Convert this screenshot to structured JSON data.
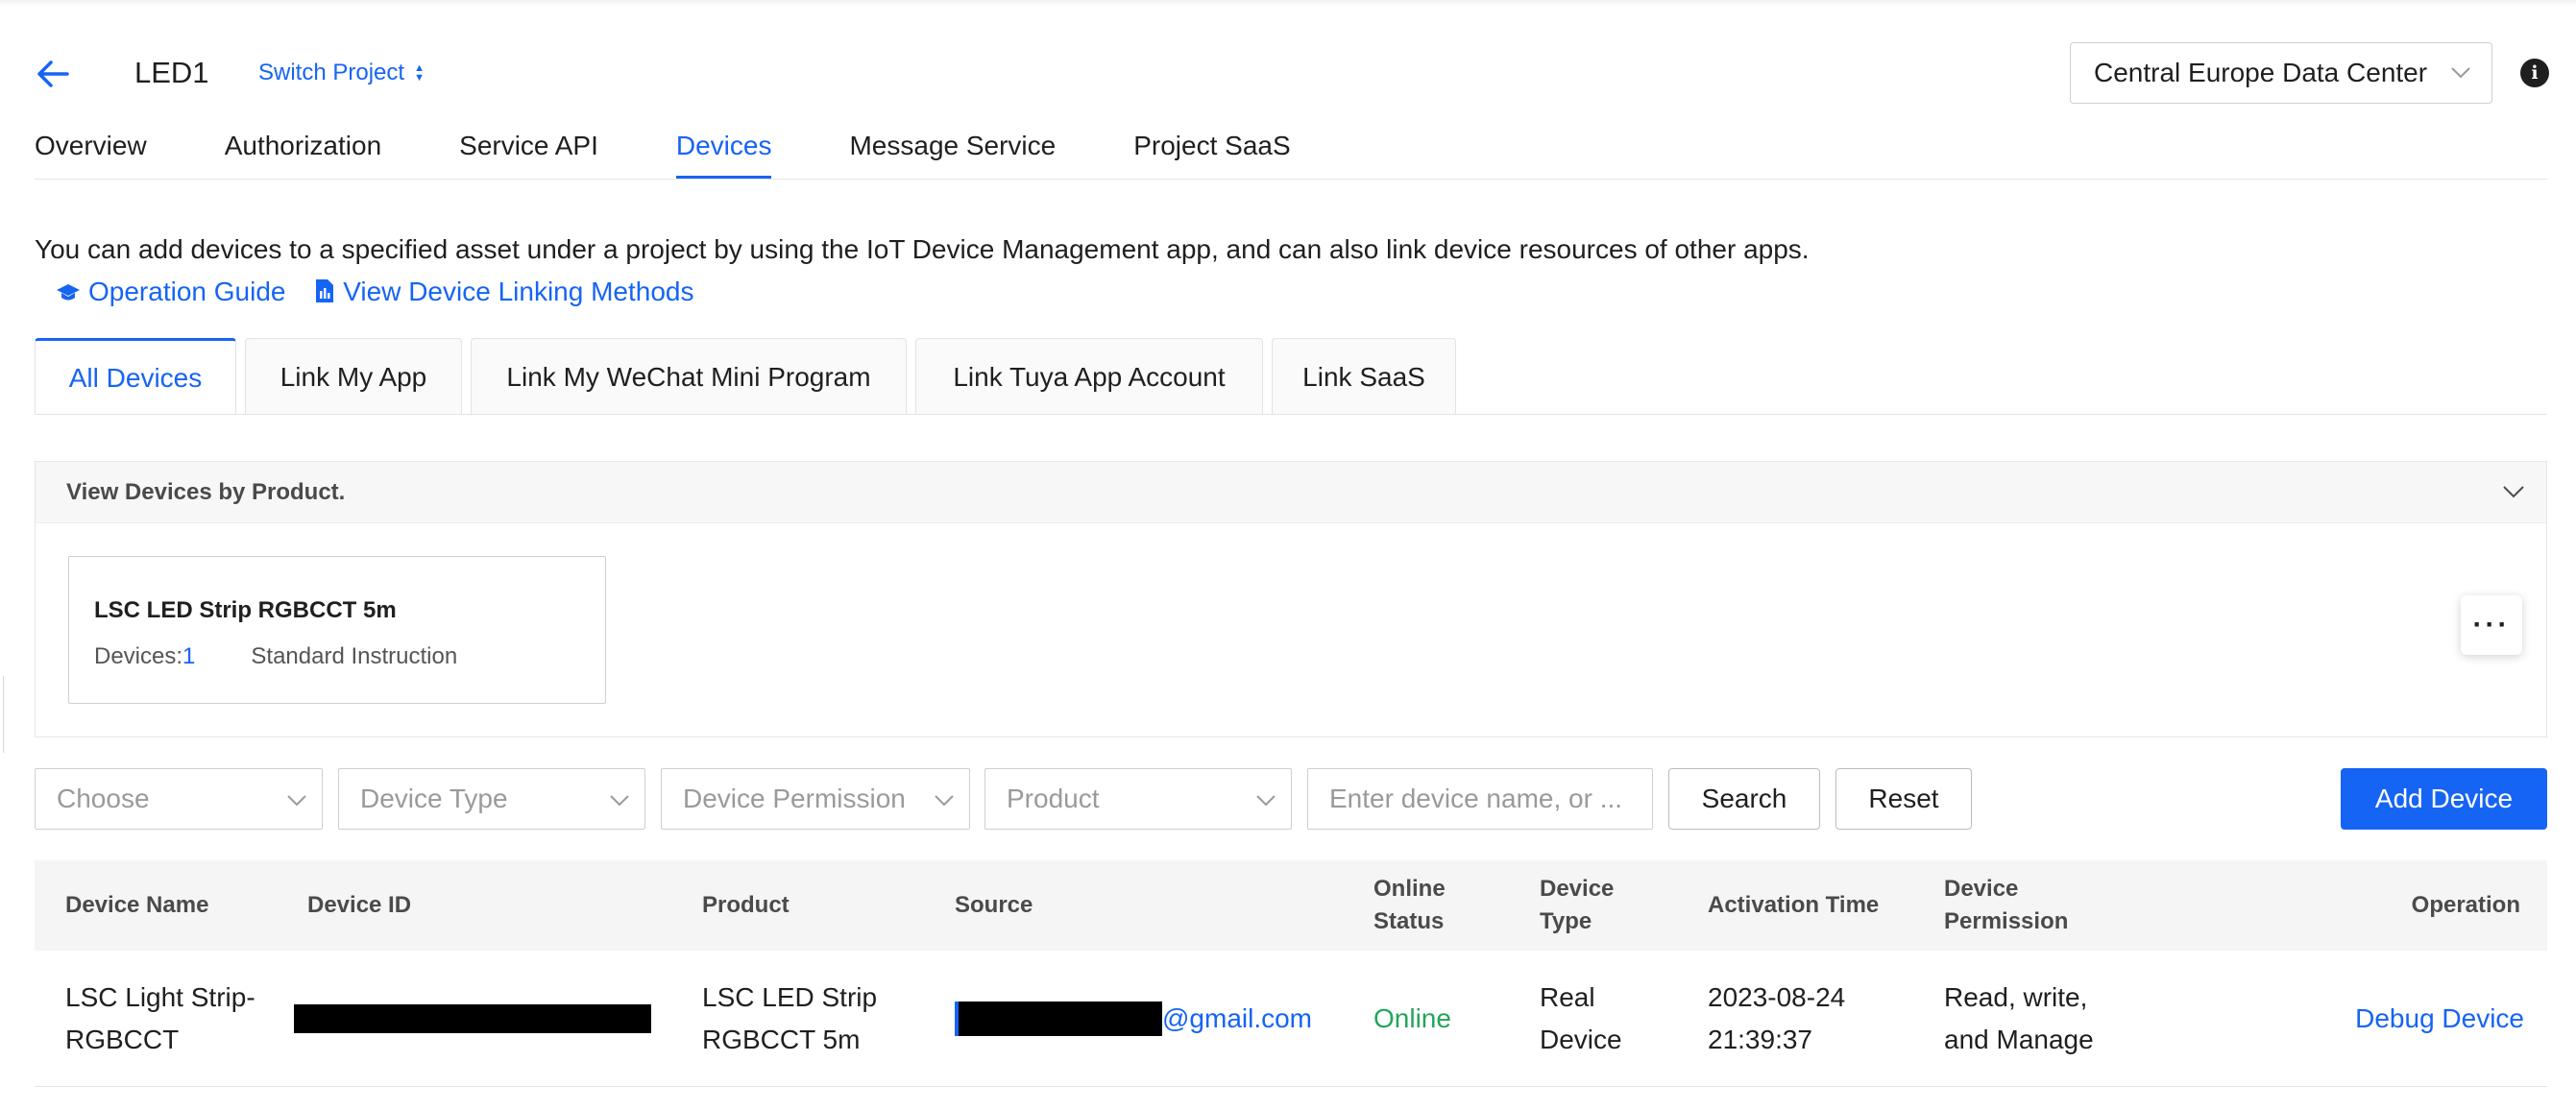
{
  "header": {
    "project_name": "LED1",
    "switch_project_label": "Switch Project",
    "data_center": "Central Europe Data Center"
  },
  "nav": {
    "tabs": [
      "Overview",
      "Authorization",
      "Service API",
      "Devices",
      "Message Service",
      "Project SaaS"
    ],
    "active": "Devices"
  },
  "description": {
    "text": "You can add devices to a specified asset under a project by using the IoT Device Management app, and can also link device resources of other apps.",
    "operation_guide": "Operation Guide",
    "linking_methods": "View Device Linking Methods"
  },
  "subtabs": {
    "items": [
      "All Devices",
      "Link My App",
      "Link My WeChat Mini Program",
      "Link Tuya App Account",
      "Link SaaS"
    ],
    "active": "All Devices"
  },
  "product_panel": {
    "title": "View Devices by Product.",
    "card": {
      "name": "LSC LED Strip RGBCCT 5m",
      "devices_label": "Devices:",
      "devices_count": "1",
      "instruction": "Standard Instruction"
    }
  },
  "filters": {
    "choose": "Choose",
    "device_type": "Device Type",
    "device_permission": "Device Permission",
    "product": "Product",
    "search_placeholder": "Enter device name, or ...",
    "search_button": "Search",
    "reset_button": "Reset",
    "add_device_button": "Add Device"
  },
  "table": {
    "headers": {
      "device_name": "Device Name",
      "device_id": "Device ID",
      "product": "Product",
      "source": "Source",
      "online_status": "Online Status",
      "device_type": "Device Type",
      "activation_time": "Activation Time",
      "device_permission": "Device Permission",
      "operation": "Operation"
    },
    "rows": [
      {
        "device_name": "LSC Light Strip-RGBCCT",
        "product": "LSC LED Strip RGBCCT 5m",
        "source_suffix": "@gmail.com",
        "online_status": "Online",
        "device_type": "Real Device",
        "activation_time": "2023-08-24 21:39:37",
        "device_permission": "Read, write, and Manage",
        "operation": "Debug Device"
      }
    ]
  },
  "colors": {
    "accent": "#1664f4",
    "online": "#23a559"
  },
  "icons": [
    "back-arrow-icon",
    "sort-arrows-icon",
    "chevron-down-icon",
    "info-icon",
    "graduation-cap-icon",
    "document-icon",
    "more-icon"
  ]
}
